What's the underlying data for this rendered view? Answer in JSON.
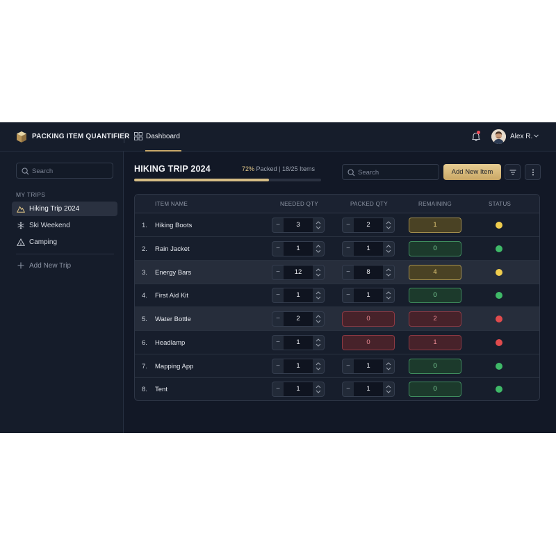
{
  "app": {
    "title": "PACKING ITEM QUANTIFIER",
    "nav_dashboard": "Dashboard",
    "user_name": "Alex R."
  },
  "sidebar": {
    "search_placeholder": "Search",
    "heading": "MY TRIPS",
    "trips": [
      {
        "label": "Hiking Trip 2024",
        "icon": "mountain-icon",
        "active": true
      },
      {
        "label": "Ski Weekend",
        "icon": "snowflake-icon",
        "active": false
      },
      {
        "label": "Camping",
        "icon": "tent-icon",
        "active": false
      }
    ],
    "add_trip_label": "Add New Trip"
  },
  "main": {
    "trip_title": "HIKING TRIP 2024",
    "packed_percent_text": "72%",
    "packed_word": "Packed",
    "separator": "|",
    "items_count_text": "18/25 Items",
    "progress_fraction": 0.72,
    "search_placeholder": "Search",
    "add_item_label": "Add New Item"
  },
  "table": {
    "columns": [
      "ITEM NAME",
      "NEEDED QTY",
      "PACKED QTY",
      "REMAINING",
      "STATUS"
    ],
    "rows": [
      {
        "num": "1.",
        "name": "Hiking Boots",
        "needed": "3",
        "packed": "2",
        "packed_editable": true,
        "remaining": "1",
        "status": "yellow",
        "highlight": false
      },
      {
        "num": "2.",
        "name": "Rain Jacket",
        "needed": "1",
        "packed": "1",
        "packed_editable": true,
        "remaining": "0",
        "status": "green",
        "highlight": false
      },
      {
        "num": "3.",
        "name": "Energy Bars",
        "needed": "12",
        "packed": "8",
        "packed_editable": true,
        "remaining": "4",
        "status": "yellow",
        "highlight": true
      },
      {
        "num": "4.",
        "name": "First Aid Kit",
        "needed": "1",
        "packed": "1",
        "packed_editable": true,
        "remaining": "0",
        "status": "green",
        "highlight": false
      },
      {
        "num": "5.",
        "name": "Water Bottle",
        "needed": "2",
        "packed": "0",
        "packed_editable": false,
        "remaining": "2",
        "status": "red",
        "highlight": true
      },
      {
        "num": "6.",
        "name": "Headlamp",
        "needed": "1",
        "packed": "0",
        "packed_editable": false,
        "remaining": "1",
        "status": "red",
        "highlight": false
      },
      {
        "num": "7.",
        "name": "Mapping App",
        "needed": "1",
        "packed": "1",
        "packed_editable": true,
        "remaining": "0",
        "status": "green",
        "highlight": false
      },
      {
        "num": "8.",
        "name": "Tent",
        "needed": "1",
        "packed": "1",
        "packed_editable": true,
        "remaining": "0",
        "status": "green",
        "highlight": false
      }
    ]
  },
  "colors": {
    "background": "#121826",
    "accent_gold": "#d6bd85",
    "status_yellow": "#f0cd4e",
    "status_green": "#3fb968",
    "status_red": "#e04b4d"
  }
}
